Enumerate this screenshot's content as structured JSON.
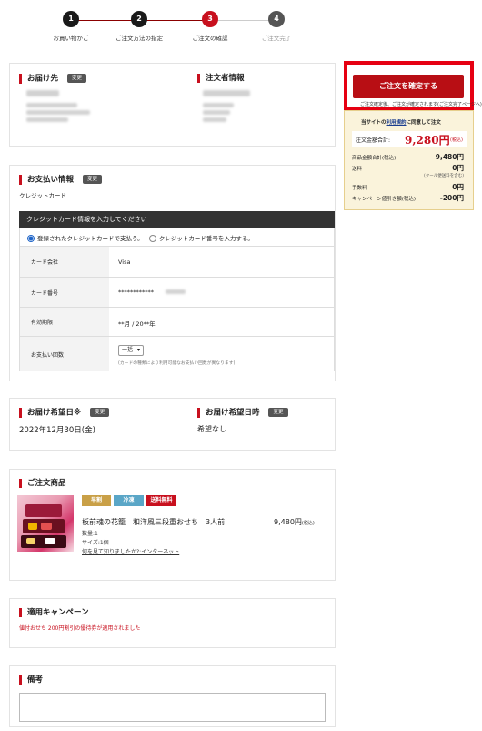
{
  "stepper": {
    "steps": [
      {
        "num": "1",
        "label": "お買い物かご"
      },
      {
        "num": "2",
        "label": "ご注文方法の指定"
      },
      {
        "num": "3",
        "label": "ご注文の確認"
      },
      {
        "num": "4",
        "label": "ご注文完了"
      }
    ],
    "current": 3
  },
  "delivery": {
    "title": "お届け先",
    "change_label": "変更",
    "orderer_title": "注文者情報"
  },
  "payment": {
    "title": "お支払い情報",
    "change_label": "変更",
    "method": "クレジットカード",
    "cc_header": "クレジットカード情報を入力してください",
    "option_registered": "登録されたクレジットカードで支払う。",
    "option_new": "クレジットカード番号を入力する。",
    "rows": {
      "company_label": "カード会社",
      "company_value": "Visa",
      "number_label": "カード番号",
      "number_value": "************",
      "expiry_label": "有効期限",
      "expiry_value": "**月 / 20**年",
      "installments_label": "お支払い回数",
      "installments_value": "一括",
      "installments_note": "(カードの種類により利用可能なお支払い回数が異なります)"
    }
  },
  "delivery_date": {
    "title": "お届け希望日※",
    "change_label": "変更",
    "value": "2022年12月30日(金)",
    "time_title": "お届け希望日時",
    "time_change_label": "変更",
    "time_value": "希望なし"
  },
  "products": {
    "title": "ご注文商品",
    "badges": [
      {
        "label": "早割",
        "color": "#c9a047"
      },
      {
        "label": "冷凍",
        "color": "#5aa6c7"
      },
      {
        "label": "送料無料",
        "color": "#c8101e"
      }
    ],
    "name": "板前魂の花籠　和洋風三段重おせち　3人前",
    "price": "9,480円",
    "price_tax": "(税込)",
    "quantity": "数量:1",
    "size": "サイズ:1個",
    "survey_link": "何を見て知りましたか?:インターネット"
  },
  "campaign": {
    "title": "適用キャンペーン",
    "text": "値付おせち 200円割引の優待券が適用されました",
    "text_color": "#c8101e"
  },
  "memo": {
    "title": "備考",
    "value": ""
  },
  "sidebar": {
    "confirm_button": "ご注文を確定する",
    "sub_text": "ご注文確定後、ご注文が確定されます(ご注文完了ページへ)",
    "agree_prefix": "当サイトの",
    "agree_link": "利用規約",
    "agree_suffix": "に同意して注文",
    "total_label": "注文金額合計:",
    "total_value": "9,280円",
    "total_tax": "(税込)",
    "breakdown": [
      {
        "label": "商品金額合計(税込)",
        "value": "9,480円"
      },
      {
        "label": "送料",
        "value": "0円",
        "note": "(クール便送料を含む)"
      },
      {
        "label": "手数料",
        "value": "0円"
      },
      {
        "label": "キャンペーン値引き額(税込)",
        "value": "-200円"
      }
    ],
    "accent": "#c8101e"
  }
}
